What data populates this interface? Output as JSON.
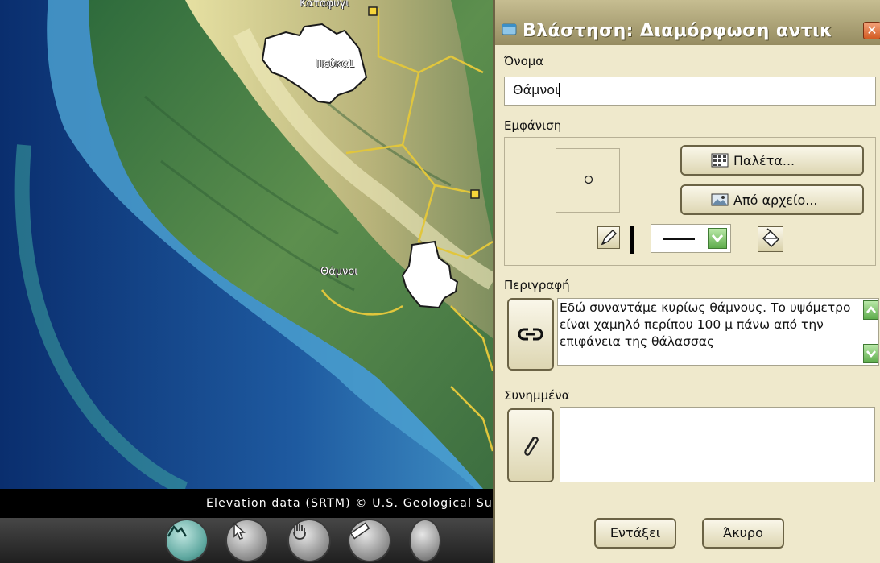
{
  "map": {
    "labels": {
      "pefka": "Πεύκα1",
      "thamnoi": "Θάμνοι",
      "top": "Καταφύγι"
    },
    "attribution": "Elevation data (SRTM) © U.S. Geological Su",
    "tools": [
      "terrain-tool",
      "select-tool",
      "pan-tool",
      "measure-tool"
    ],
    "colors": {
      "sea_deep": "#0d3a7a",
      "land": "#3f7a45",
      "highland": "#d6cf8d",
      "overlay": "#ffffff"
    }
  },
  "dialog": {
    "title": "Βλάστηση: Διαμόρφωση αντικ",
    "close": "✕",
    "name_label": "Όνομα",
    "name_value": "Θάμνοι",
    "appearance_label": "Εμφάνιση",
    "palette_button": "Παλέτα...",
    "from_file_button": "Από αρχείο...",
    "description_label": "Περιγραφή",
    "description_text": "Εδώ συναντάμε κυρίως θάμνους. Το υψόμετρο είναι χαμηλό περίπου 100 μ πάνω από την επιφάνεια της θάλασσας",
    "attachments_label": "Συνημμένα",
    "ok_button": "Εντάξει",
    "cancel_button": "Άκυρο",
    "colors": {
      "dialog_bg": "#efe9cc",
      "titlebar": "#b0a67a",
      "close": "#d35b22",
      "accent_green": "#5eac4c"
    }
  }
}
